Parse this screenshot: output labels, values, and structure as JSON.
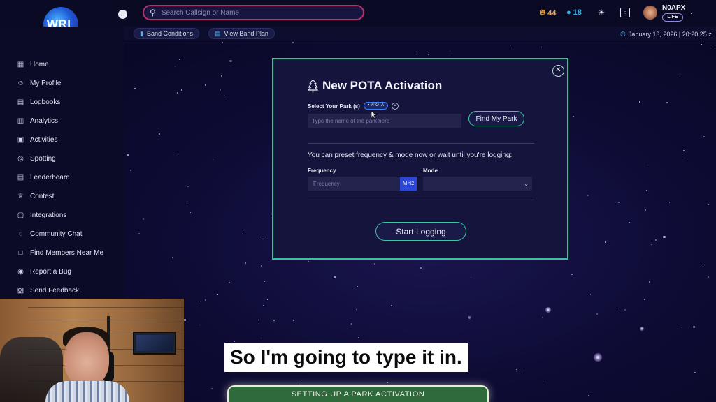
{
  "header": {
    "logo_text": "WRL",
    "search_placeholder": "Search Callsign or Name",
    "streak_orange": "44",
    "streak_cyan": "18",
    "callsign": "N0APX",
    "badge": "LIFE"
  },
  "subbar": {
    "band_conditions": "Band Conditions",
    "view_band_plan": "View Band Plan",
    "datetime": "January 13, 2026 | 20:20:25 z"
  },
  "sidebar": {
    "items": [
      {
        "label": "Home",
        "icon": "grid-icon"
      },
      {
        "label": "My Profile",
        "icon": "user-icon"
      },
      {
        "label": "Logbooks",
        "icon": "book-icon"
      },
      {
        "label": "Analytics",
        "icon": "chart-icon"
      },
      {
        "label": "Activities",
        "icon": "activity-icon"
      },
      {
        "label": "Spotting",
        "icon": "target-icon"
      },
      {
        "label": "Leaderboard",
        "icon": "leaderboard-icon"
      },
      {
        "label": "Contest",
        "icon": "trophy-icon"
      },
      {
        "label": "Integrations",
        "icon": "plug-icon"
      },
      {
        "label": "Community Chat",
        "icon": "chat-icon"
      },
      {
        "label": "Find Members Near Me",
        "icon": "location-icon"
      },
      {
        "label": "Report a Bug",
        "icon": "bug-icon"
      },
      {
        "label": "Send Feedback",
        "icon": "feedback-icon"
      }
    ]
  },
  "modal": {
    "title": "New POTA Activation",
    "select_park_label": "Select Your Park (s)",
    "pota_tag": "• #POTA",
    "park_placeholder": "Type the name of the park here",
    "find_my_park": "Find My Park",
    "preset_text": "You can preset frequency & mode now or wait until you're logging:",
    "frequency_label": "Frequency",
    "frequency_placeholder": "Frequency",
    "mhz": "MHz",
    "mode_label": "Mode",
    "start_logging": "Start Logging"
  },
  "overlay": {
    "caption": "So I'm going to type it in.",
    "banner": "SETTING UP A PARK ACTIVATION"
  },
  "colors": {
    "accent_green": "#36c49a",
    "search_border": "#b8316a",
    "mhz_blue": "#2c47d8",
    "banner_green": "#2f6a3c"
  }
}
